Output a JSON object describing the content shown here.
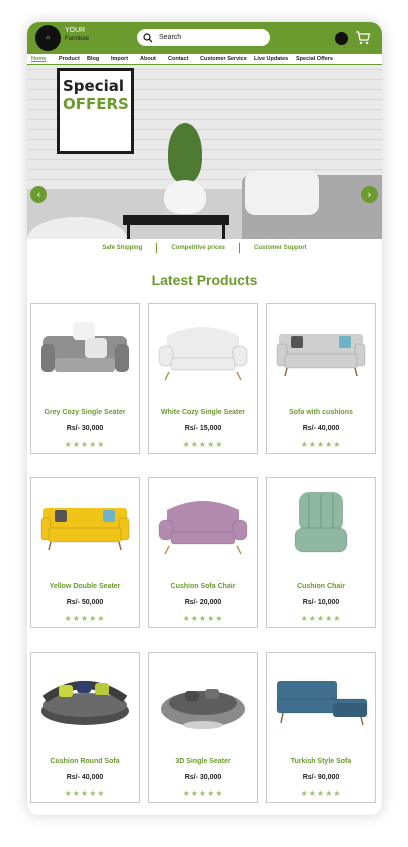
{
  "brand": {
    "line1": "YOUR",
    "line2": "Furniture",
    "logo_mark": "⌂"
  },
  "search": {
    "placeholder": "Search"
  },
  "nav": {
    "items": [
      "Home",
      "Product",
      "Blog",
      "Import",
      "About",
      "Contact",
      "Customer Service",
      "Live Updates",
      "Special Offers"
    ]
  },
  "hero": {
    "line1": "Special",
    "line2": "OFFERS"
  },
  "features": [
    "Safe Shipping",
    "Competitive prices",
    "Customer Support"
  ],
  "section_title": "Latest Products",
  "products": [
    {
      "name": "Grey Cozy Single Seater",
      "price": "Rs/- 30,000",
      "stars": "★★★★★",
      "color": "#8f8f8f",
      "style": "armchair"
    },
    {
      "name": "White Cozy Single Seater",
      "price": "Rs/- 15,000",
      "stars": "★★★★★",
      "color": "#ececec",
      "style": "loveseat"
    },
    {
      "name": "Sofa with cushions",
      "price": "Rs/- 40,000",
      "stars": "★★★★★",
      "color": "#cfcfcf",
      "style": "sofa"
    },
    {
      "name": "Yellow Double Seater",
      "price": "Rs/- 50,000",
      "stars": "★★★★★",
      "color": "#f0c419",
      "style": "sofa"
    },
    {
      "name": "Cushion Sofa Chair",
      "price": "Rs/- 20,000",
      "stars": "★★★★★",
      "color": "#b48bb0",
      "style": "loveseat"
    },
    {
      "name": "Cushion Chair",
      "price": "Rs/- 10,000",
      "stars": "★★★★★",
      "color": "#8fb7a1",
      "style": "chair"
    },
    {
      "name": "Cushion Round Sofa",
      "price": "Rs/- 40,000",
      "stars": "★★★★★",
      "color": "#5a5a5a",
      "style": "round"
    },
    {
      "name": "3D Single Seater",
      "price": "Rs/- 30,000",
      "stars": "★★★★★",
      "color": "#7a7a7a",
      "style": "pod"
    },
    {
      "name": "Turkish Style Sofa",
      "price": "Rs/- 90,000",
      "stars": "★★★★★",
      "color": "#3f6f8c",
      "style": "sectional"
    }
  ]
}
